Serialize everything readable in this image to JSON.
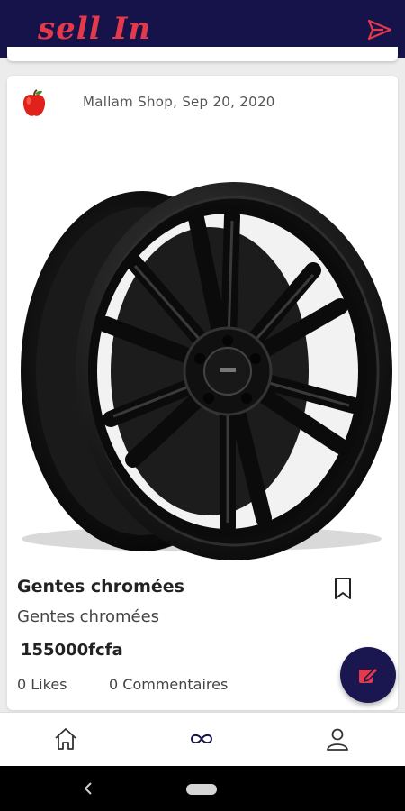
{
  "app": {
    "logo_text": "sell In"
  },
  "post": {
    "shop_line": "Mallam Shop, Sep 20, 2020",
    "title": "Gentes chromées",
    "subtitle": "Gentes chromées",
    "price": "155000fcfa",
    "likes": "0 Likes",
    "comments": "0 Commentaires"
  },
  "colors": {
    "accent": "#e23a4a",
    "brand": "#16124a"
  },
  "icons": {
    "header_send": "send-icon",
    "bookmark": "bookmark-icon",
    "fab": "edit-icon",
    "nav": [
      "home-icon",
      "infinity-icon",
      "user-icon"
    ],
    "system": [
      "back-icon",
      "home-pill"
    ]
  }
}
